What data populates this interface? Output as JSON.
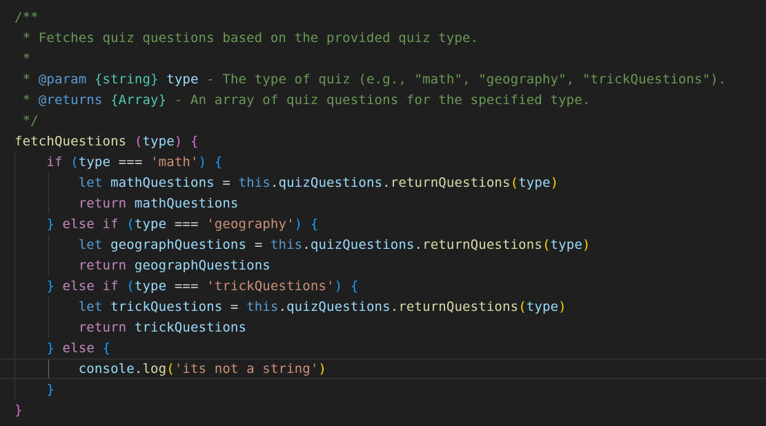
{
  "theme": {
    "background": "#1f1f1f",
    "comment": "#6a9955",
    "jsdoc_tag": "#569cd6",
    "jsdoc_type": "#4ec9b0",
    "keyword_control": "#c586c0",
    "keyword_storage": "#569cd6",
    "function": "#dcdcaa",
    "variable": "#9cdcfe",
    "string": "#ce9178",
    "text": "#d4d4d4",
    "bracket_1": "#ffd700",
    "bracket_2": "#da70d6",
    "bracket_3": "#179fff"
  },
  "code": {
    "lines": [
      {
        "guides": [],
        "current": false,
        "tokens": [
          {
            "t": "/**",
            "c": "comment"
          }
        ]
      },
      {
        "guides": [],
        "current": false,
        "tokens": [
          {
            "t": " * Fetches quiz questions based on the provided quiz type.",
            "c": "comment"
          }
        ]
      },
      {
        "guides": [],
        "current": false,
        "tokens": [
          {
            "t": " *",
            "c": "comment"
          }
        ]
      },
      {
        "guides": [],
        "current": false,
        "tokens": [
          {
            "t": " * ",
            "c": "comment"
          },
          {
            "t": "@param",
            "c": "jsdoc_tag"
          },
          {
            "t": " ",
            "c": "comment"
          },
          {
            "t": "{string}",
            "c": "jsdoc_type"
          },
          {
            "t": " ",
            "c": "comment"
          },
          {
            "t": "type",
            "c": "variable"
          },
          {
            "t": " - The type of quiz (e.g., \"math\", \"geography\", \"trickQuestions\").",
            "c": "comment"
          }
        ]
      },
      {
        "guides": [],
        "current": false,
        "tokens": [
          {
            "t": " * ",
            "c": "comment"
          },
          {
            "t": "@returns",
            "c": "jsdoc_tag"
          },
          {
            "t": " ",
            "c": "comment"
          },
          {
            "t": "{Array}",
            "c": "jsdoc_type"
          },
          {
            "t": " - An array of quiz questions for the specified type.",
            "c": "comment"
          }
        ]
      },
      {
        "guides": [],
        "current": false,
        "tokens": [
          {
            "t": " */",
            "c": "comment"
          }
        ]
      },
      {
        "guides": [],
        "current": false,
        "tokens": [
          {
            "t": "fetchQuestions",
            "c": "function"
          },
          {
            "t": " ",
            "c": "text"
          },
          {
            "t": "(",
            "c": "bracket_2"
          },
          {
            "t": "type",
            "c": "variable"
          },
          {
            "t": ")",
            "c": "bracket_2"
          },
          {
            "t": " ",
            "c": "text"
          },
          {
            "t": "{",
            "c": "bracket_2"
          }
        ]
      },
      {
        "guides": [
          0
        ],
        "current": false,
        "tokens": [
          {
            "t": "    ",
            "c": "text"
          },
          {
            "t": "if",
            "c": "keyword_control"
          },
          {
            "t": " ",
            "c": "text"
          },
          {
            "t": "(",
            "c": "bracket_3"
          },
          {
            "t": "type",
            "c": "variable"
          },
          {
            "t": " === ",
            "c": "text"
          },
          {
            "t": "'math'",
            "c": "string"
          },
          {
            "t": ")",
            "c": "bracket_3"
          },
          {
            "t": " ",
            "c": "text"
          },
          {
            "t": "{",
            "c": "bracket_3"
          }
        ]
      },
      {
        "guides": [
          0,
          1
        ],
        "current": false,
        "tokens": [
          {
            "t": "        ",
            "c": "text"
          },
          {
            "t": "let",
            "c": "keyword_storage"
          },
          {
            "t": " ",
            "c": "text"
          },
          {
            "t": "mathQuestions",
            "c": "variable"
          },
          {
            "t": " = ",
            "c": "text"
          },
          {
            "t": "this",
            "c": "keyword_storage"
          },
          {
            "t": ".",
            "c": "text"
          },
          {
            "t": "quizQuestions",
            "c": "variable"
          },
          {
            "t": ".",
            "c": "text"
          },
          {
            "t": "returnQuestions",
            "c": "function"
          },
          {
            "t": "(",
            "c": "bracket_1"
          },
          {
            "t": "type",
            "c": "variable"
          },
          {
            "t": ")",
            "c": "bracket_1"
          }
        ]
      },
      {
        "guides": [
          0,
          1
        ],
        "current": false,
        "tokens": [
          {
            "t": "        ",
            "c": "text"
          },
          {
            "t": "return",
            "c": "keyword_control"
          },
          {
            "t": " ",
            "c": "text"
          },
          {
            "t": "mathQuestions",
            "c": "variable"
          }
        ]
      },
      {
        "guides": [
          0
        ],
        "current": false,
        "tokens": [
          {
            "t": "    ",
            "c": "text"
          },
          {
            "t": "}",
            "c": "bracket_3"
          },
          {
            "t": " ",
            "c": "text"
          },
          {
            "t": "else",
            "c": "keyword_control"
          },
          {
            "t": " ",
            "c": "text"
          },
          {
            "t": "if",
            "c": "keyword_control"
          },
          {
            "t": " ",
            "c": "text"
          },
          {
            "t": "(",
            "c": "bracket_3"
          },
          {
            "t": "type",
            "c": "variable"
          },
          {
            "t": " === ",
            "c": "text"
          },
          {
            "t": "'geography'",
            "c": "string"
          },
          {
            "t": ")",
            "c": "bracket_3"
          },
          {
            "t": " ",
            "c": "text"
          },
          {
            "t": "{",
            "c": "bracket_3"
          }
        ]
      },
      {
        "guides": [
          0,
          1
        ],
        "current": false,
        "tokens": [
          {
            "t": "        ",
            "c": "text"
          },
          {
            "t": "let",
            "c": "keyword_storage"
          },
          {
            "t": " ",
            "c": "text"
          },
          {
            "t": "geographQuestions",
            "c": "variable"
          },
          {
            "t": " = ",
            "c": "text"
          },
          {
            "t": "this",
            "c": "keyword_storage"
          },
          {
            "t": ".",
            "c": "text"
          },
          {
            "t": "quizQuestions",
            "c": "variable"
          },
          {
            "t": ".",
            "c": "text"
          },
          {
            "t": "returnQuestions",
            "c": "function"
          },
          {
            "t": "(",
            "c": "bracket_1"
          },
          {
            "t": "type",
            "c": "variable"
          },
          {
            "t": ")",
            "c": "bracket_1"
          }
        ]
      },
      {
        "guides": [
          0,
          1
        ],
        "current": false,
        "tokens": [
          {
            "t": "        ",
            "c": "text"
          },
          {
            "t": "return",
            "c": "keyword_control"
          },
          {
            "t": " ",
            "c": "text"
          },
          {
            "t": "geographQuestions",
            "c": "variable"
          }
        ]
      },
      {
        "guides": [
          0
        ],
        "current": false,
        "tokens": [
          {
            "t": "    ",
            "c": "text"
          },
          {
            "t": "}",
            "c": "bracket_3"
          },
          {
            "t": " ",
            "c": "text"
          },
          {
            "t": "else",
            "c": "keyword_control"
          },
          {
            "t": " ",
            "c": "text"
          },
          {
            "t": "if",
            "c": "keyword_control"
          },
          {
            "t": " ",
            "c": "text"
          },
          {
            "t": "(",
            "c": "bracket_3"
          },
          {
            "t": "type",
            "c": "variable"
          },
          {
            "t": " === ",
            "c": "text"
          },
          {
            "t": "'trickQuestions'",
            "c": "string"
          },
          {
            "t": ")",
            "c": "bracket_3"
          },
          {
            "t": " ",
            "c": "text"
          },
          {
            "t": "{",
            "c": "bracket_3"
          }
        ]
      },
      {
        "guides": [
          0,
          1
        ],
        "current": false,
        "tokens": [
          {
            "t": "        ",
            "c": "text"
          },
          {
            "t": "let",
            "c": "keyword_storage"
          },
          {
            "t": " ",
            "c": "text"
          },
          {
            "t": "trickQuestions",
            "c": "variable"
          },
          {
            "t": " = ",
            "c": "text"
          },
          {
            "t": "this",
            "c": "keyword_storage"
          },
          {
            "t": ".",
            "c": "text"
          },
          {
            "t": "quizQuestions",
            "c": "variable"
          },
          {
            "t": ".",
            "c": "text"
          },
          {
            "t": "returnQuestions",
            "c": "function"
          },
          {
            "t": "(",
            "c": "bracket_1"
          },
          {
            "t": "type",
            "c": "variable"
          },
          {
            "t": ")",
            "c": "bracket_1"
          }
        ]
      },
      {
        "guides": [
          0,
          1
        ],
        "current": false,
        "tokens": [
          {
            "t": "        ",
            "c": "text"
          },
          {
            "t": "return",
            "c": "keyword_control"
          },
          {
            "t": " ",
            "c": "text"
          },
          {
            "t": "trickQuestions",
            "c": "variable"
          }
        ]
      },
      {
        "guides": [
          0
        ],
        "current": false,
        "tokens": [
          {
            "t": "    ",
            "c": "text"
          },
          {
            "t": "}",
            "c": "bracket_3"
          },
          {
            "t": " ",
            "c": "text"
          },
          {
            "t": "else",
            "c": "keyword_control"
          },
          {
            "t": " ",
            "c": "text"
          },
          {
            "t": "{",
            "c": "bracket_3"
          }
        ]
      },
      {
        "guides": [
          0,
          1
        ],
        "active_guide": 1,
        "current": true,
        "tokens": [
          {
            "t": "        ",
            "c": "text"
          },
          {
            "t": "console",
            "c": "variable"
          },
          {
            "t": ".",
            "c": "text"
          },
          {
            "t": "log",
            "c": "function"
          },
          {
            "t": "(",
            "c": "bracket_1"
          },
          {
            "t": "'its not a string'",
            "c": "string"
          },
          {
            "t": ")",
            "c": "bracket_1"
          }
        ]
      },
      {
        "guides": [
          0
        ],
        "current": false,
        "tokens": [
          {
            "t": "    ",
            "c": "text"
          },
          {
            "t": "}",
            "c": "bracket_3"
          }
        ]
      },
      {
        "guides": [],
        "current": false,
        "tokens": [
          {
            "t": "}",
            "c": "bracket_2"
          }
        ]
      }
    ]
  }
}
